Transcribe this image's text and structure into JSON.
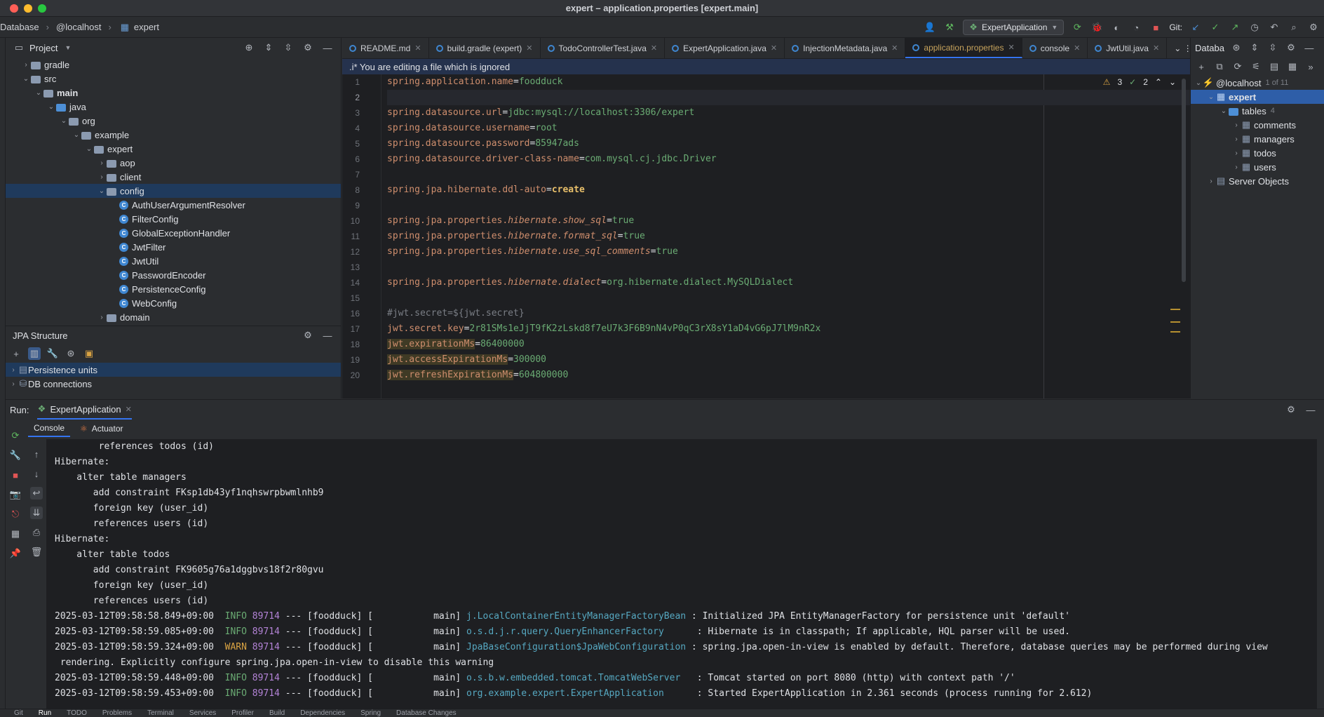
{
  "window": {
    "title": "expert – application.properties [expert.main]"
  },
  "navbar": {
    "crumbs": [
      "Database",
      "@localhost",
      "expert"
    ],
    "run_config": "ExpertApplication",
    "git_label": "Git:"
  },
  "project": {
    "header": "Project",
    "tree": [
      {
        "label": "gradle",
        "indent": 1,
        "kind": "folder",
        "open": false
      },
      {
        "label": "src",
        "indent": 1,
        "kind": "folder",
        "open": true
      },
      {
        "label": "main",
        "indent": 2,
        "kind": "folder",
        "open": true,
        "bold": true
      },
      {
        "label": "java",
        "indent": 3,
        "kind": "folder-blue",
        "open": true
      },
      {
        "label": "org",
        "indent": 4,
        "kind": "folder",
        "open": true
      },
      {
        "label": "example",
        "indent": 5,
        "kind": "folder",
        "open": true
      },
      {
        "label": "expert",
        "indent": 6,
        "kind": "folder",
        "open": true
      },
      {
        "label": "aop",
        "indent": 7,
        "kind": "folder",
        "open": false
      },
      {
        "label": "client",
        "indent": 7,
        "kind": "folder",
        "open": false
      },
      {
        "label": "config",
        "indent": 7,
        "kind": "folder",
        "open": true,
        "selected": true
      },
      {
        "label": "AuthUserArgumentResolver",
        "indent": 8,
        "kind": "class"
      },
      {
        "label": "FilterConfig",
        "indent": 8,
        "kind": "class"
      },
      {
        "label": "GlobalExceptionHandler",
        "indent": 8,
        "kind": "class"
      },
      {
        "label": "JwtFilter",
        "indent": 8,
        "kind": "class"
      },
      {
        "label": "JwtUtil",
        "indent": 8,
        "kind": "class"
      },
      {
        "label": "PasswordEncoder",
        "indent": 8,
        "kind": "class"
      },
      {
        "label": "PersistenceConfig",
        "indent": 8,
        "kind": "class"
      },
      {
        "label": "WebConfig",
        "indent": 8,
        "kind": "class"
      },
      {
        "label": "domain",
        "indent": 7,
        "kind": "folder",
        "open": false
      }
    ]
  },
  "jpa": {
    "header": "JPA Structure",
    "items": [
      "Persistence units",
      "DB connections"
    ]
  },
  "tabs": [
    {
      "label": "README.md"
    },
    {
      "label": "build.gradle (expert)"
    },
    {
      "label": "TodoControllerTest.java"
    },
    {
      "label": "ExpertApplication.java"
    },
    {
      "label": "InjectionMetadata.java"
    },
    {
      "label": "application.properties",
      "active": true
    },
    {
      "label": "console"
    },
    {
      "label": "JwtUtil.java"
    }
  ],
  "editor": {
    "notice": ".i* You are editing a file which is ignored",
    "warnings": "3",
    "checks": "2",
    "lines": [
      {
        "n": "1",
        "parts": [
          [
            "k",
            "spring.application.name"
          ],
          [
            "t",
            "="
          ],
          [
            "v",
            "foodduck"
          ]
        ]
      },
      {
        "n": "2",
        "parts": []
      },
      {
        "n": "3",
        "parts": [
          [
            "k",
            "spring.datasource.url"
          ],
          [
            "t",
            "="
          ],
          [
            "v",
            "jdbc:mysql://localhost:3306/expert"
          ]
        ]
      },
      {
        "n": "4",
        "parts": [
          [
            "k",
            "spring.datasource.username"
          ],
          [
            "t",
            "="
          ],
          [
            "v",
            "root"
          ]
        ]
      },
      {
        "n": "5",
        "parts": [
          [
            "k",
            "spring.datasource.password"
          ],
          [
            "t",
            "="
          ],
          [
            "v",
            "85947ads"
          ]
        ]
      },
      {
        "n": "6",
        "parts": [
          [
            "k",
            "spring.datasource.driver-class-name"
          ],
          [
            "t",
            "="
          ],
          [
            "v",
            "com.mysql.cj.jdbc.Driver"
          ]
        ]
      },
      {
        "n": "7",
        "parts": []
      },
      {
        "n": "8",
        "parts": [
          [
            "k",
            "spring.jpa.hibernate.ddl-auto"
          ],
          [
            "t",
            "="
          ],
          [
            "b",
            "create"
          ]
        ]
      },
      {
        "n": "9",
        "parts": []
      },
      {
        "n": "10",
        "parts": [
          [
            "k",
            "spring.jpa.properties."
          ],
          [
            "it",
            "hibernate.show_sql"
          ],
          [
            "t",
            "="
          ],
          [
            "v",
            "true"
          ]
        ]
      },
      {
        "n": "11",
        "parts": [
          [
            "k",
            "spring.jpa.properties."
          ],
          [
            "it",
            "hibernate.format_sql"
          ],
          [
            "t",
            "="
          ],
          [
            "v",
            "true"
          ]
        ]
      },
      {
        "n": "12",
        "parts": [
          [
            "k",
            "spring.jpa.properties."
          ],
          [
            "it",
            "hibernate.use_sql_comments"
          ],
          [
            "t",
            "="
          ],
          [
            "v",
            "true"
          ]
        ]
      },
      {
        "n": "13",
        "parts": []
      },
      {
        "n": "14",
        "parts": [
          [
            "k",
            "spring.jpa.properties."
          ],
          [
            "it",
            "hibernate.dialect"
          ],
          [
            "t",
            "="
          ],
          [
            "v",
            "org.hibernate.dialect.MySQLDialect"
          ]
        ]
      },
      {
        "n": "15",
        "parts": []
      },
      {
        "n": "16",
        "parts": [
          [
            "cm",
            "#jwt.secret=${jwt.secret}"
          ]
        ]
      },
      {
        "n": "17",
        "parts": [
          [
            "k",
            "jwt.secret.key"
          ],
          [
            "t",
            "="
          ],
          [
            "v",
            "2r81SMs1eJjT9fK2zLskd8f7eU7k3F6B9nN4vP0qC3rX8sY1aD4vG6pJ7lM9nR2x"
          ]
        ]
      },
      {
        "n": "18",
        "parts": [
          [
            "hk",
            "jwt.expirationMs"
          ],
          [
            "t",
            "="
          ],
          [
            "v",
            "86400000"
          ]
        ]
      },
      {
        "n": "19",
        "parts": [
          [
            "hk",
            "jwt.accessExpirationMs"
          ],
          [
            "t",
            "="
          ],
          [
            "v",
            "300000"
          ]
        ]
      },
      {
        "n": "20",
        "parts": [
          [
            "hk",
            "jwt.refreshExpirationMs"
          ],
          [
            "t",
            "="
          ],
          [
            "v",
            "604800000"
          ]
        ]
      }
    ]
  },
  "db": {
    "header": "Databa",
    "host": "@localhost",
    "host_count": "1 of 11",
    "schema": "expert",
    "tables_label": "tables",
    "tables_count": "4",
    "tables": [
      "comments",
      "managers",
      "todos",
      "users"
    ],
    "server": "Server Objects"
  },
  "run": {
    "label": "Run:",
    "tab": "ExpertApplication",
    "subtabs": [
      "Console",
      "Actuator"
    ],
    "lines": [
      {
        "plain": "        references todos (id)"
      },
      {
        "plain": "Hibernate: "
      },
      {
        "plain": "    alter table managers "
      },
      {
        "plain": "       add constraint FKsp1db43yf1nqhswrpbwmlnhb9 "
      },
      {
        "plain": "       foreign key (user_id) "
      },
      {
        "plain": "       references users (id)"
      },
      {
        "plain": "Hibernate: "
      },
      {
        "plain": "    alter table todos "
      },
      {
        "plain": "       add constraint FK9605g76a1dggbvs18f2r80gvu "
      },
      {
        "plain": "       foreign key (user_id) "
      },
      {
        "plain": "       references users (id)"
      },
      {
        "ts": "2025-03-12T09:58:58.849+09:00",
        "lvl": "INFO",
        "pid": "89714",
        "mid": " --- [foodduck] [           main] ",
        "logger": "j.LocalContainerEntityManagerFactoryBean",
        "msg": " : Initialized JPA EntityManagerFactory for persistence unit 'default'"
      },
      {
        "ts": "2025-03-12T09:58:59.085+09:00",
        "lvl": "INFO",
        "pid": "89714",
        "mid": " --- [foodduck] [           main] ",
        "logger": "o.s.d.j.r.query.QueryEnhancerFactory     ",
        "msg": " : Hibernate is in classpath; If applicable, HQL parser will be used."
      },
      {
        "ts": "2025-03-12T09:58:59.324+09:00",
        "lvl": "WARN",
        "pid": "89714",
        "mid": " --- [foodduck] [           main] ",
        "logger": "JpaBaseConfiguration$JpaWebConfiguration",
        "msg": " : spring.jpa.open-in-view is enabled by default. Therefore, database queries may be performed during view"
      },
      {
        "plain": " rendering. Explicitly configure spring.jpa.open-in-view to disable this warning"
      },
      {
        "ts": "2025-03-12T09:58:59.448+09:00",
        "lvl": "INFO",
        "pid": "89714",
        "mid": " --- [foodduck] [           main] ",
        "logger": "o.s.b.w.embedded.tomcat.TomcatWebServer  ",
        "msg": " : Tomcat started on port 8080 (http) with context path '/'"
      },
      {
        "ts": "2025-03-12T09:58:59.453+09:00",
        "lvl": "INFO",
        "pid": "89714",
        "mid": " --- [foodduck] [           main] ",
        "logger": "org.example.expert.ExpertApplication     ",
        "msg": " : Started ExpertApplication in 2.361 seconds (process running for 2.612)"
      }
    ]
  },
  "statusbar": [
    "Git",
    "Run",
    "TODO",
    "Problems",
    "Terminal",
    "Services",
    "Profiler",
    "Build",
    "Dependencies",
    "Spring",
    "Database Changes"
  ],
  "colors": {
    "accent": "#3574f0",
    "selection": "#1f3a5c",
    "db_selection": "#2e5ea8"
  }
}
